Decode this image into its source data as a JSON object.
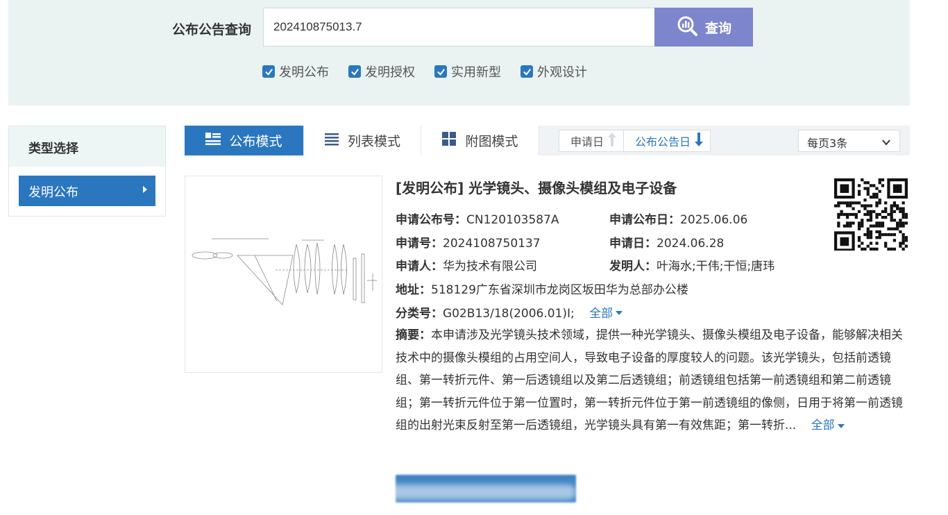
{
  "search": {
    "label": "公布公告查询",
    "value": "202410875013.7",
    "button_label": "查询"
  },
  "filters": [
    {
      "label": "发明公布",
      "checked": true
    },
    {
      "label": "发明授权",
      "checked": true
    },
    {
      "label": "实用新型",
      "checked": true
    },
    {
      "label": "外观设计",
      "checked": true
    }
  ],
  "sidebar": {
    "title": "类型选择",
    "items": [
      {
        "label": "发明公布",
        "active": true
      }
    ]
  },
  "toolbar": {
    "tabs": [
      {
        "label": "公布模式",
        "active": true,
        "icon": "publish-mode-icon"
      },
      {
        "label": "列表模式",
        "active": false,
        "icon": "list-icon"
      },
      {
        "label": "附图模式",
        "active": false,
        "icon": "grid-icon"
      }
    ],
    "sort": [
      {
        "label": "申请日",
        "icon": "arrow-up-icon"
      },
      {
        "label": "公布公告日",
        "icon": "arrow-down-icon"
      }
    ],
    "per_page": "每页3条"
  },
  "result": {
    "title": "[发明公布] 光学镜头、摄像头模组及电子设备",
    "pub_no_label": "申请公布号：",
    "pub_no": "CN120103587A",
    "pub_date_label": "申请公布日：",
    "pub_date": "2025.06.06",
    "app_no_label": "申请号：",
    "app_no": "2024108750137",
    "app_date_label": "申请日：",
    "app_date": "2024.06.28",
    "applicant_label": "申请人：",
    "applicant": "华为技术有限公司",
    "inventor_label": "发明人：",
    "inventor": "叶海水;干伟;干恒;唐玮",
    "address_label": "地址：",
    "address": "518129广东省深圳市龙岗区坂田华为总部办公楼",
    "class_label": "分类号：",
    "class": "G02B13/18(2006.01)I;",
    "class_more": "全部",
    "abstract_label": "摘要：",
    "abstract": "本申请涉及光学镜头技术领域，提供一种光学镜头、摄像头模组及电子设备，能够解决相关技术中的摄像头模组的占用空间人，导致电子设备的厚度较人的问题。该光学镜头，包括前透镜组、第一转折元件、第一后透镜组以及第二后透镜组；前透镜组包括第一前透镜组和第二前透镜组；第一转折元件位于第一位置时，第一转折元件位于第一前透镜组的像侧，日用于将第一前透镜组的出射光束反射至第一后透镜组，光学镜头具有第一有效焦距；第一转折...",
    "abstract_more": "全部"
  },
  "colors": {
    "primary": "#2b77bf",
    "search_button": "#7d86cc",
    "band": "#eaf3f2"
  }
}
